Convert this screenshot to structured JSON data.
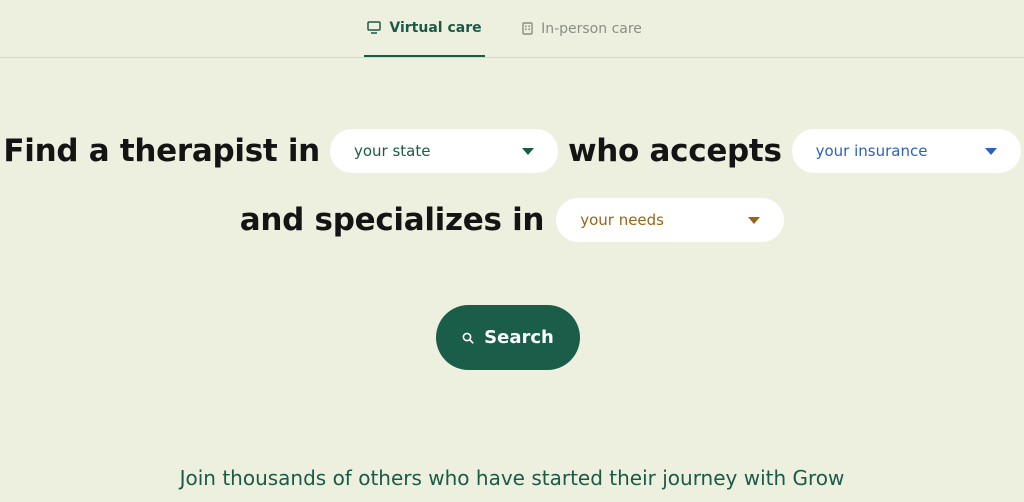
{
  "tabs": [
    {
      "label": "Virtual care",
      "icon": "monitor-icon",
      "active": true
    },
    {
      "label": "In-person care",
      "icon": "building-icon",
      "active": false
    }
  ],
  "sentence": {
    "part1": "Find a therapist in",
    "part2": "who accepts",
    "part3": "and specializes in"
  },
  "selects": {
    "state": {
      "value": "your state",
      "color": "#1b5a47"
    },
    "insurance": {
      "value": "your insurance",
      "color": "#2d5fc0"
    },
    "needs": {
      "value": "your needs",
      "color": "#9a6418"
    }
  },
  "search": {
    "label": "Search",
    "icon": "search-icon"
  },
  "tagline": "Join thousands of others who have started their journey with Grow",
  "colors": {
    "background": "#edf0df",
    "accent": "#1a5d48"
  }
}
